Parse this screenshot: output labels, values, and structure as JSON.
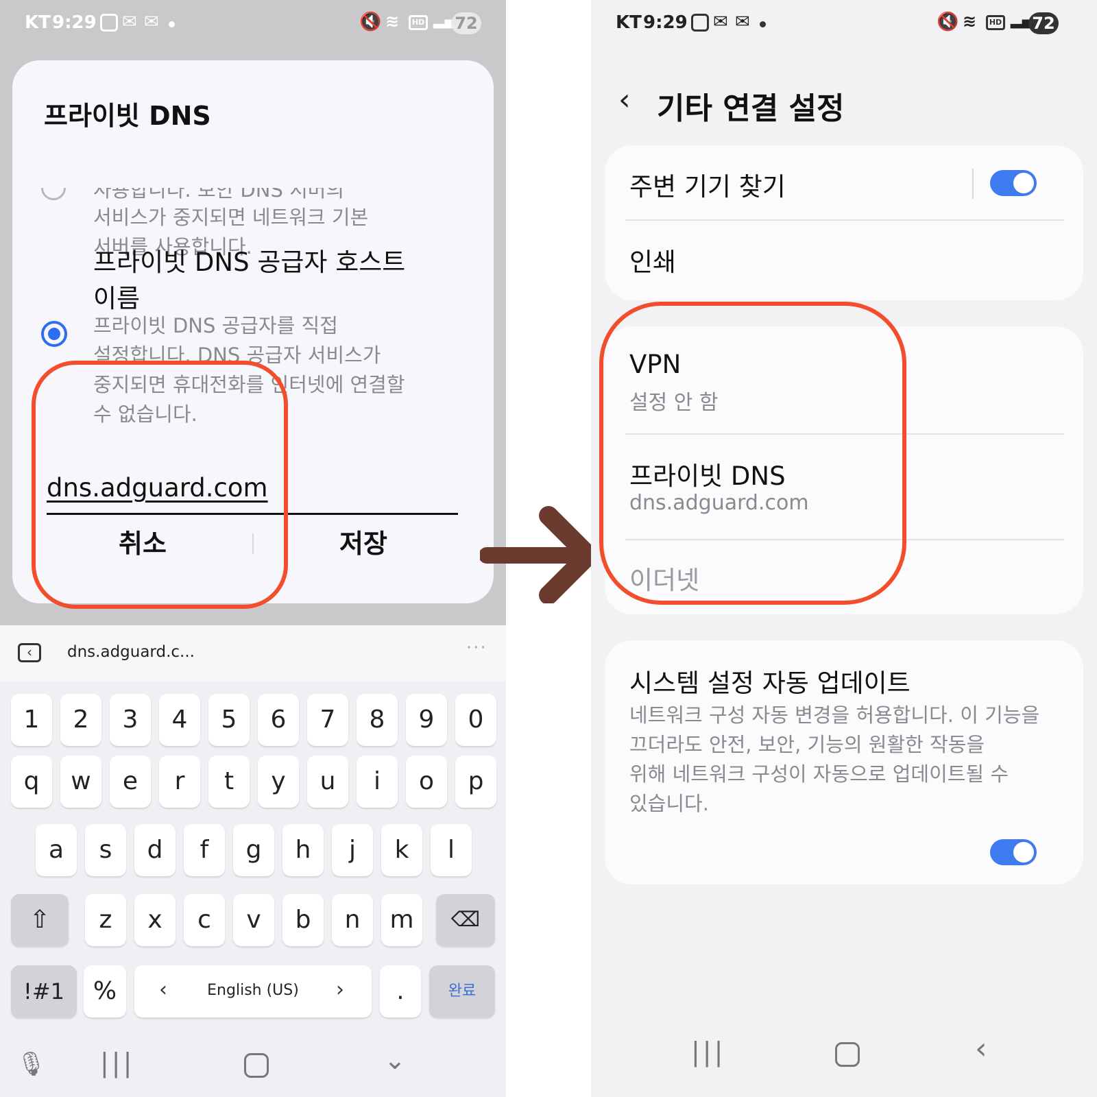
{
  "status_bar": {
    "carrier": "KT",
    "time": "9:29",
    "battery": "72"
  },
  "left": {
    "dialog": {
      "title": "프라이빗 DNS",
      "cut_text": "사용합니다. 보안 DNS 서버의",
      "auto_desc_line1": "서비스가 중지되면 네트워크 기본",
      "auto_desc_line2": "서버를 사용합니다.",
      "hostname_option": {
        "title_line1": "프라이빗 DNS 공급자 호스트",
        "title_line2": "이름",
        "desc_line1": "프라이빗 DNS 공급자를 직접",
        "desc_line2": "설정합니다. DNS 공급자 서비스가",
        "desc_line3": "중지되면 휴대전화를 인터넷에 연결할",
        "desc_line4": "수 없습니다."
      },
      "hostname_value": "dns.adguard.com",
      "cancel_label": "취소",
      "save_label": "저장"
    },
    "keyboard": {
      "suggestion": "dns.adguard.c...",
      "row_numbers": [
        "1",
        "2",
        "3",
        "4",
        "5",
        "6",
        "7",
        "8",
        "9",
        "0"
      ],
      "row_q": [
        "q",
        "w",
        "e",
        "r",
        "t",
        "y",
        "u",
        "i",
        "o",
        "p"
      ],
      "row_a": [
        "a",
        "s",
        "d",
        "f",
        "g",
        "h",
        "j",
        "k",
        "l"
      ],
      "row_z": [
        "z",
        "x",
        "c",
        "v",
        "b",
        "n",
        "m"
      ],
      "symbols_label": "!#1",
      "percent_label": "%",
      "space_label": "English (US)",
      "period_label": ".",
      "done_label": "완료"
    }
  },
  "right": {
    "page_title": "기타 연결 설정",
    "nearby_label": "주변 기기 찾기",
    "nearby_on": true,
    "print_label": "인쇄",
    "vpn_label": "VPN",
    "vpn_status": "설정 안 함",
    "private_dns_label": "프라이빗 DNS",
    "private_dns_value": "dns.adguard.com",
    "ethernet_label": "이더넷",
    "auto_update_title": "시스템 설정 자동 업데이트",
    "auto_update_line1": "네트워크 구성 자동 변경을 허용합니다. 이 기능을",
    "auto_update_line2": "끄더라도 안전, 보안, 기능의 원활한 작동을",
    "auto_update_line3": "위해 네트워크 구성이 자동으로 업데이트될 수",
    "auto_update_line4": "있습니다.",
    "auto_update_on": true
  },
  "colors": {
    "highlight": "#f24e2d",
    "arrow": "#6b3a2e",
    "toggle_on": "#3e7bf0",
    "radio_selected": "#2f6df0"
  }
}
